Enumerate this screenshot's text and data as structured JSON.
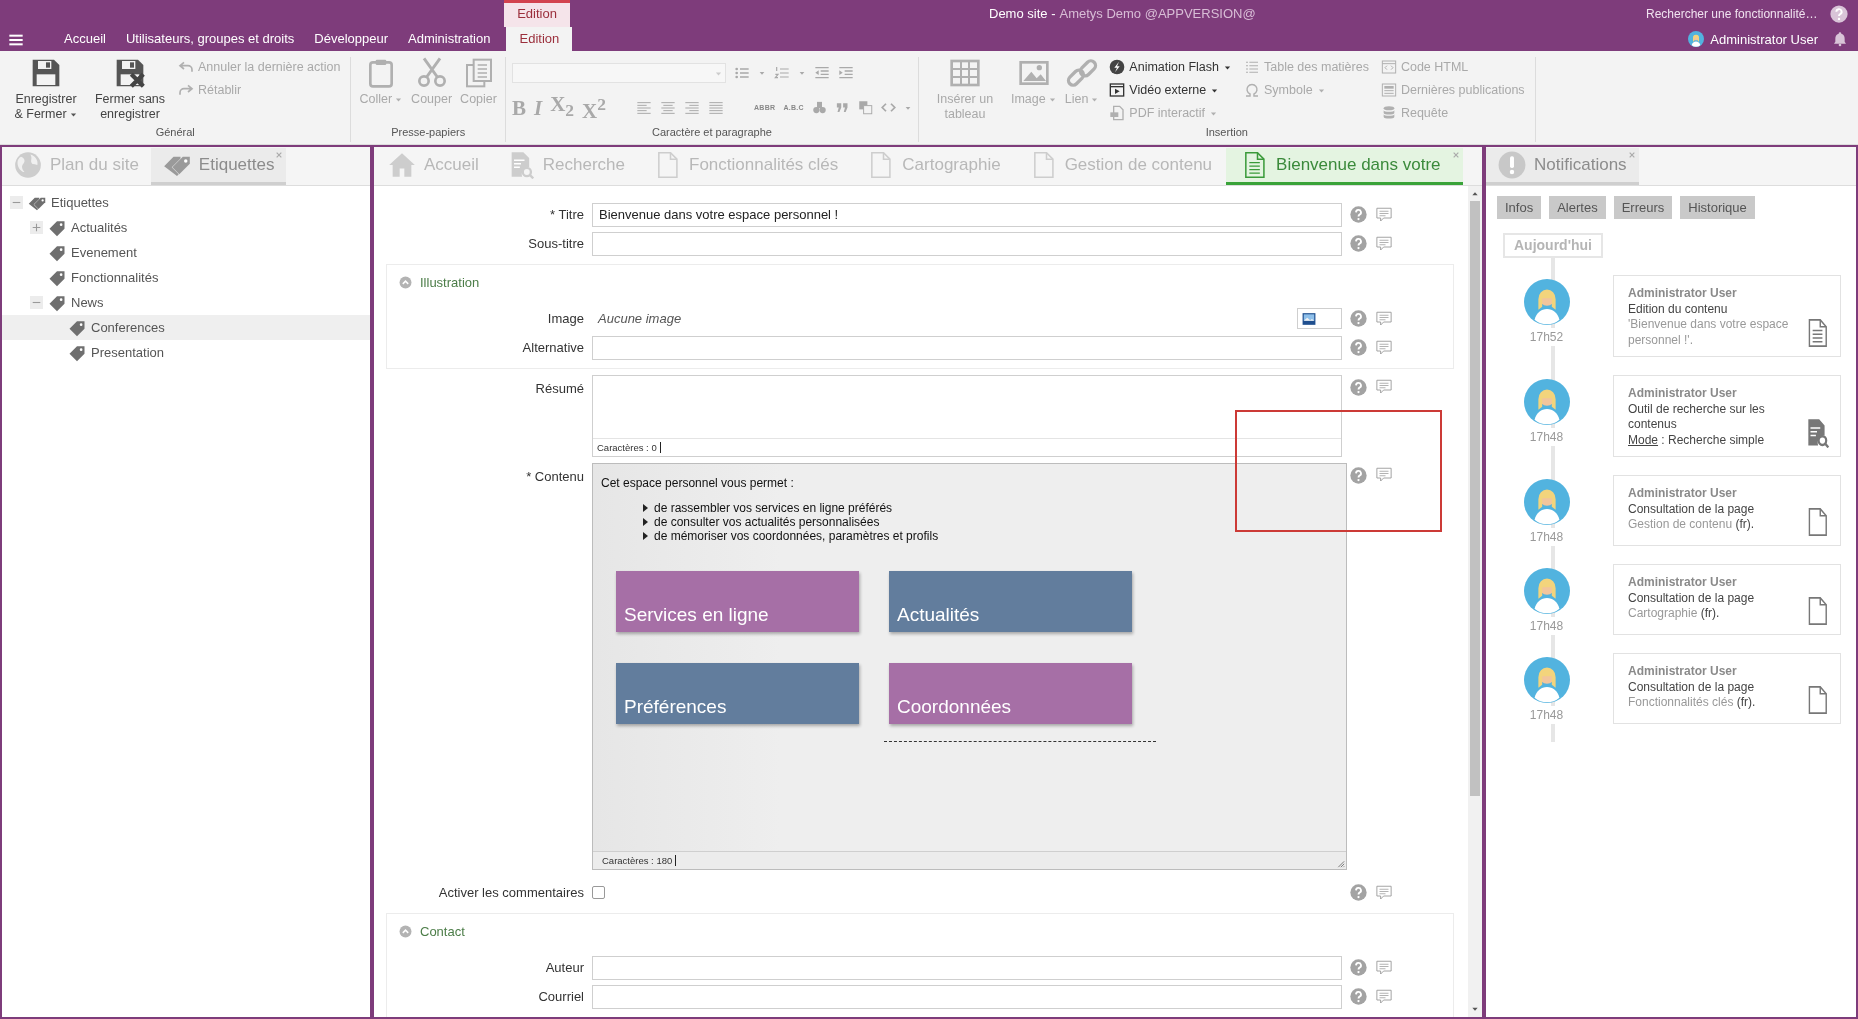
{
  "header": {
    "contextual_group": "Edition",
    "site": "Demo site -",
    "app": "Ametys Demo @APPVERSION@",
    "search_placeholder": "Rechercher une fonctionnalité…",
    "tabs": [
      {
        "label": "Accueil",
        "selected": false
      },
      {
        "label": "Utilisateurs, groupes et droits",
        "selected": false
      },
      {
        "label": "Développeur",
        "selected": false
      },
      {
        "label": "Administration",
        "selected": false
      },
      {
        "label": "Edition",
        "selected": true
      }
    ],
    "user": "Administrator User"
  },
  "ribbon": {
    "groups": [
      {
        "label": "Général",
        "items": [
          {
            "kind": "large",
            "label": "Enregistrer & Fermer",
            "dropdown": true,
            "disabled": false
          },
          {
            "kind": "large",
            "label": "Fermer sans enregistrer",
            "dropdown": false,
            "disabled": false
          },
          {
            "kind": "stack",
            "items": [
              {
                "label": "Annuler la dernière action",
                "dropdown": false,
                "disabled": true
              },
              {
                "label": "Rétablir",
                "dropdown": false,
                "disabled": true
              }
            ]
          }
        ]
      },
      {
        "label": "Presse-papiers",
        "items": [
          {
            "kind": "large",
            "label": "Coller",
            "dropdown": true,
            "disabled": true
          },
          {
            "kind": "large",
            "label": "Couper",
            "dropdown": false,
            "disabled": true
          },
          {
            "kind": "large",
            "label": "Copier",
            "dropdown": false,
            "disabled": true
          }
        ]
      },
      {
        "label": "Caractère et paragraphe",
        "items": [
          {
            "kind": "format",
            "disabled": true,
            "text_buttons": [
              "B",
              "I",
              "X$_{2}$",
              "X$^{2}$"
            ],
            "tags": [
              "ABBR",
              "A.B.C"
            ]
          }
        ]
      },
      {
        "label": "Insertion",
        "items": [
          {
            "kind": "large",
            "label": "Insérer un tableau",
            "dropdown": false,
            "disabled": true
          },
          {
            "kind": "large",
            "label": "Image",
            "dropdown": true,
            "disabled": true
          },
          {
            "kind": "large",
            "label": "Lien",
            "dropdown": true,
            "disabled": true
          },
          {
            "kind": "stack",
            "items": [
              {
                "label": "Animation Flash",
                "dropdown": true,
                "disabled": false
              },
              {
                "label": "Vidéo externe",
                "dropdown": true,
                "disabled": false
              },
              {
                "label": "PDF interactif",
                "dropdown": true,
                "disabled": true
              }
            ]
          },
          {
            "kind": "stack",
            "items": [
              {
                "label": "Table des matières",
                "dropdown": false,
                "disabled": true
              },
              {
                "label": "Symbole",
                "dropdown": true,
                "disabled": true
              }
            ]
          },
          {
            "kind": "stack",
            "items": [
              {
                "label": "Code HTML",
                "dropdown": false,
                "disabled": true
              },
              {
                "label": "Dernières publications",
                "dropdown": false,
                "disabled": true
              },
              {
                "label": "Requête",
                "dropdown": false,
                "disabled": true
              }
            ]
          }
        ]
      }
    ]
  },
  "left_panel": {
    "tabs": [
      {
        "label": "Plan du site",
        "selected": false,
        "closable": false
      },
      {
        "label": "Etiquettes",
        "selected": true,
        "closable": true
      }
    ],
    "tree": [
      {
        "label": "Etiquettes",
        "expanded": true,
        "selected": false,
        "children": [
          {
            "label": "Actualités",
            "expanded": false,
            "selected": false
          },
          {
            "label": "Evenement",
            "selected": false
          },
          {
            "label": "Fonctionnalités",
            "selected": false
          },
          {
            "label": "News",
            "expanded": true,
            "selected": false,
            "children": [
              {
                "label": "Conferences",
                "selected": true
              },
              {
                "label": "Presentation",
                "selected": false
              }
            ]
          }
        ]
      }
    ]
  },
  "editor": {
    "tabs": [
      {
        "label": "Accueil",
        "selected": false,
        "closable": false
      },
      {
        "label": "Recherche",
        "selected": false,
        "closable": false
      },
      {
        "label": "Fonctionnalités clés",
        "selected": false,
        "closable": false
      },
      {
        "label": "Cartographie",
        "selected": false,
        "closable": false
      },
      {
        "label": "Gestion de contenu",
        "selected": false,
        "closable": false
      },
      {
        "label": "Bienvenue dans votre",
        "selected": true,
        "closable": true
      }
    ],
    "fields": [
      {
        "kind": "text",
        "label": "* Titre",
        "value": "Bienvenue dans votre espace personnel !"
      },
      {
        "kind": "text",
        "label": "Sous-titre"
      },
      {
        "kind": "section",
        "label": "Illustration",
        "expanded": true,
        "fields": [
          {
            "kind": "image",
            "label": "Image",
            "value": "Aucune image"
          },
          {
            "kind": "text",
            "label": "Alternative"
          }
        ]
      },
      {
        "kind": "textarea",
        "label": "Résumé",
        "counter": "Caractères : 0"
      },
      {
        "kind": "richtext",
        "label": "* Contenu",
        "intro": "Cet espace personnel vous permet :",
        "bullets": [
          "de rassembler vos services en ligne préférés",
          "de consulter vos actualités personnalisées",
          "de mémoriser vos coordonnées, paramètres et profils"
        ],
        "tiles": [
          {
            "label": "Services en ligne",
            "color": "#a66fa6"
          },
          {
            "label": "Actualités",
            "color": "#627d9d"
          },
          {
            "label": "Préférences",
            "color": "#627d9d"
          },
          {
            "label": "Coordonnées",
            "color": "#a66fa6"
          }
        ],
        "counter": "Caractères : 180"
      },
      {
        "kind": "checkbox",
        "label": "Activer les commentaires",
        "checked": false
      },
      {
        "kind": "section",
        "label": "Contact",
        "expanded": true,
        "fields": [
          {
            "kind": "text",
            "label": "Auteur"
          },
          {
            "kind": "text",
            "label": "Courriel"
          }
        ]
      }
    ]
  },
  "notifications": {
    "tabs": [
      {
        "label": "Notifications",
        "selected": true,
        "closable": true
      }
    ],
    "filters": [
      "Infos",
      "Alertes",
      "Erreurs",
      "Historique"
    ],
    "day": "Aujourd'hui",
    "entries": [
      {
        "kind": "document",
        "time": "17h52",
        "author": "Administrator User",
        "action": "Edition du contenu",
        "detail": [
          {
            "text": "'Bienvenue dans votre espace personnel !'.",
            "kind": "muted"
          }
        ]
      },
      {
        "kind": "search",
        "time": "17h48",
        "author": "Administrator User",
        "action": "Outil de recherche sur les contenus",
        "detail": [
          {
            "text": "Mode",
            "kind": "link"
          },
          {
            "text": " : Recherche simple",
            "kind": "plain"
          }
        ]
      },
      {
        "kind": "page",
        "time": "17h48",
        "author": "Administrator User",
        "action": "Consultation de la page",
        "detail": [
          {
            "text": "Gestion de contenu",
            "kind": "muted"
          },
          {
            "text": " (fr).",
            "kind": "plain"
          }
        ]
      },
      {
        "kind": "page",
        "time": "17h48",
        "author": "Administrator User",
        "action": "Consultation de la page",
        "detail": [
          {
            "text": "Cartographie",
            "kind": "muted"
          },
          {
            "text": " (fr).",
            "kind": "plain"
          }
        ]
      },
      {
        "kind": "page",
        "time": "17h48",
        "author": "Administrator User",
        "action": "Consultation de la page",
        "detail": [
          {
            "text": "Fonctionnalités clés",
            "kind": "muted"
          },
          {
            "text": " (fr).",
            "kind": "plain"
          }
        ]
      }
    ]
  }
}
